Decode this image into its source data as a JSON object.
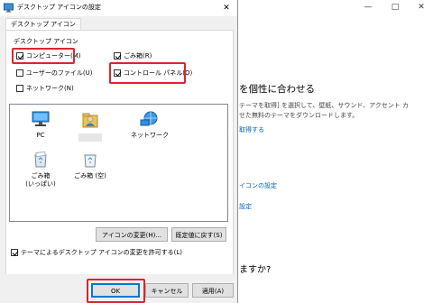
{
  "background_window": {
    "heading": "を個性に合わせる",
    "desc_line1": "テーマを取得] を選択して、壁紙、サウンド、アクセント カ",
    "desc_line2": "せた無料のテーマをダウンロードします。",
    "link_get_more": "取得する",
    "link_icon_settings": "イコンの設定",
    "link_setting": "設定",
    "question": "ますか?",
    "controls": {
      "minimize": "—",
      "maximize": "□",
      "close": "✕"
    }
  },
  "dialog": {
    "title": "デスクトップ アイコンの設定",
    "close_glyph": "✕",
    "tab_label": "デスクトップ アイコン",
    "group_label": "デスクトップ アイコン",
    "checkboxes": [
      {
        "label": "コンピューター(M)",
        "checked": true
      },
      {
        "label": "ごみ箱(R)",
        "checked": true
      },
      {
        "label": "ユーザーのファイル(U)",
        "checked": false
      },
      {
        "label": "コントロール パネル(O)",
        "checked": true
      },
      {
        "label": "ネットワーク(N)",
        "checked": false
      }
    ],
    "icons": [
      {
        "label": "PC",
        "icon": "computer-icon"
      },
      {
        "label": "",
        "icon": "user-folder-icon"
      },
      {
        "label": "ネットワーク",
        "icon": "network-icon"
      },
      {
        "label": "ごみ箱\n(いっぱい)",
        "icon": "recycle-bin-full-icon"
      },
      {
        "label": "ごみ箱 (空)",
        "icon": "recycle-bin-empty-icon"
      }
    ],
    "change_icon_button": "アイコンの変更(H)...",
    "restore_default_button": "既定値に戻す(S)",
    "allow_themes_checkbox": {
      "label": "テーマによるデスクトップ アイコンの変更を許可する(L)",
      "checked": true
    },
    "ok_button": "OK",
    "cancel_button": "キャンセル",
    "apply_button": "適用(A)",
    "colors": {
      "highlight": "#d8262f",
      "link": "#0063b1"
    }
  }
}
